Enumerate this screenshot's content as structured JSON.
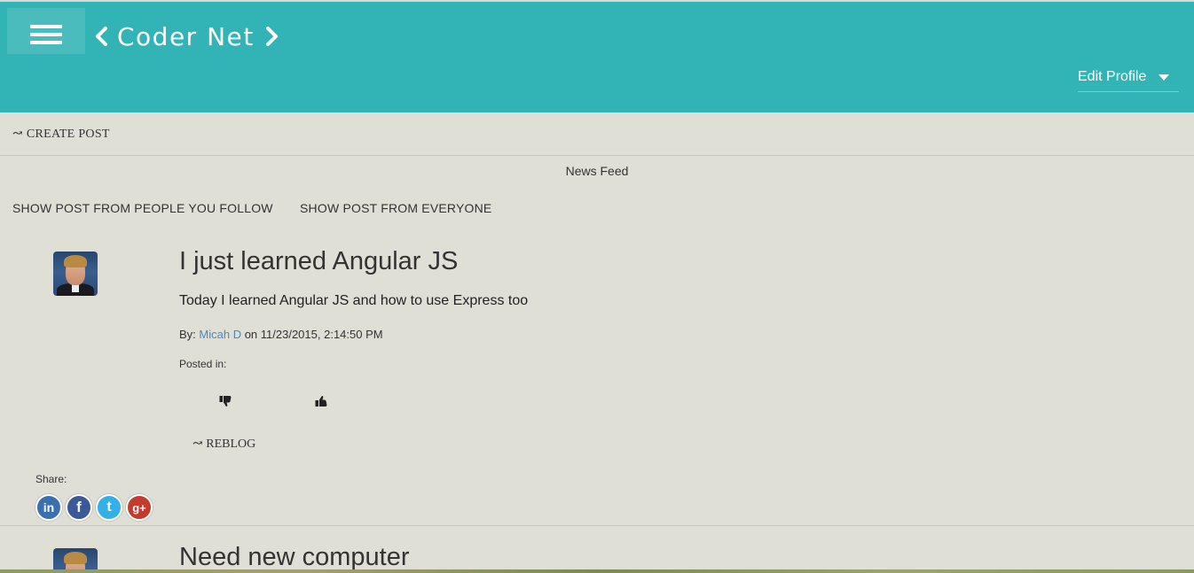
{
  "header": {
    "brand_title": "Coder Net",
    "edit_profile_label": "Edit Profile",
    "background_color": "#32b3b5",
    "icons": [
      "menu-icon",
      "chevron-left-icon",
      "chevron-right-icon",
      "caret-down-icon"
    ]
  },
  "toolbar": {
    "create_post_label": "↝ CREATE POST"
  },
  "feed": {
    "title": "News Feed",
    "filters": [
      "SHOW POST FROM PEOPLE YOU FOLLOW",
      "SHOW POST FROM EVERYONE"
    ]
  },
  "posts": [
    {
      "title": "I just learned Angular JS",
      "body": "Today I learned Angular JS and how to use Express too",
      "by_label": "By: ",
      "author": "Micah D",
      "date_text": " on 11/23/2015, 2:14:50 PM",
      "posted_in_label": "Posted in:",
      "reblog_label": "↝ REBLOG",
      "share_label": "Share:",
      "share_buttons": [
        {
          "name": "linkedin",
          "glyph": "in",
          "color": "#3a6fb0"
        },
        {
          "name": "facebook",
          "glyph": "f",
          "color": "#3b5998"
        },
        {
          "name": "twitter",
          "glyph": "t",
          "color": "#33b0e6"
        },
        {
          "name": "google-plus",
          "glyph": "g+",
          "color": "#c23b2c"
        }
      ]
    },
    {
      "title": "Need new computer"
    }
  ]
}
